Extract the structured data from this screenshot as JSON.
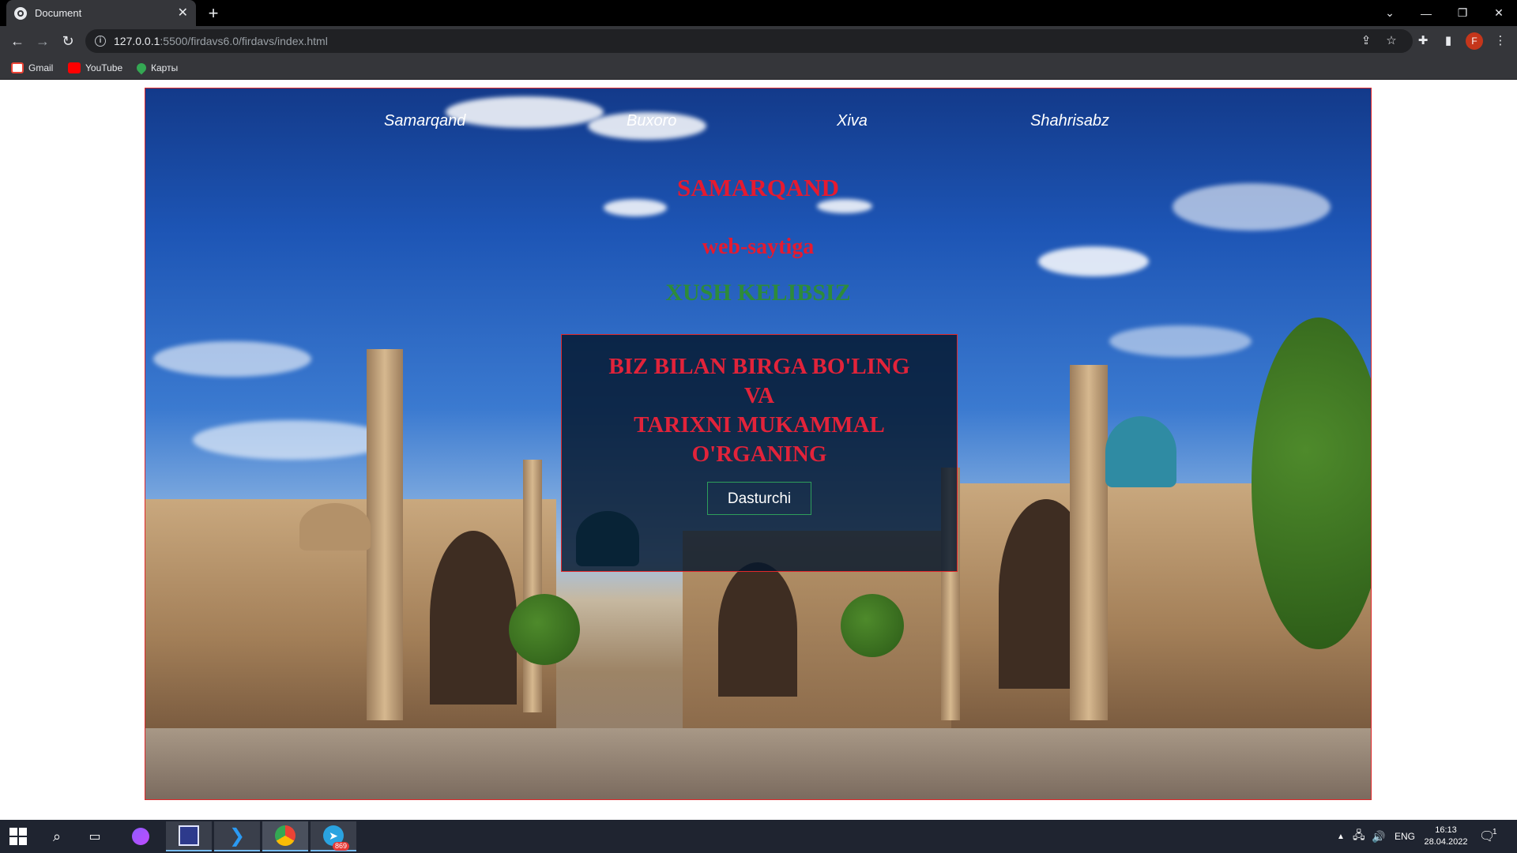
{
  "browser": {
    "tab_title": "Document",
    "tab_close": "✕",
    "new_tab": "+",
    "url_host": "127.0.0.1",
    "url_path": ":5500/firdavs6.0/firdavs/index.html",
    "profile_initial": "F",
    "bookmarks": [
      {
        "label": "Gmail",
        "icon": "gmail-icon"
      },
      {
        "label": "YouTube",
        "icon": "youtube-icon"
      },
      {
        "label": "Карты",
        "icon": "maps-icon"
      }
    ]
  },
  "page": {
    "nav": [
      "Samarqand",
      "Buxoro",
      "Xiva",
      "Shahrisabz"
    ],
    "title": "SAMARQAND",
    "subtitle": "web-saytiga",
    "welcome": "XUSH KELIBSIZ",
    "panel": {
      "line1": "BIZ BILAN BIRGA BO'LING",
      "line2": "VA",
      "line3": "TARIXNI MUKAMMAL",
      "line4": "O'RGANING",
      "button_label": "Dasturchi"
    }
  },
  "taskbar": {
    "language": "ENG",
    "time": "16:13",
    "date": "28.04.2022",
    "telegram_badge": "869",
    "notification_count": "1"
  },
  "colors": {
    "accent_red": "#e61a2f",
    "welcome_green": "#2e8b3a",
    "border_red": "#e0282a"
  }
}
